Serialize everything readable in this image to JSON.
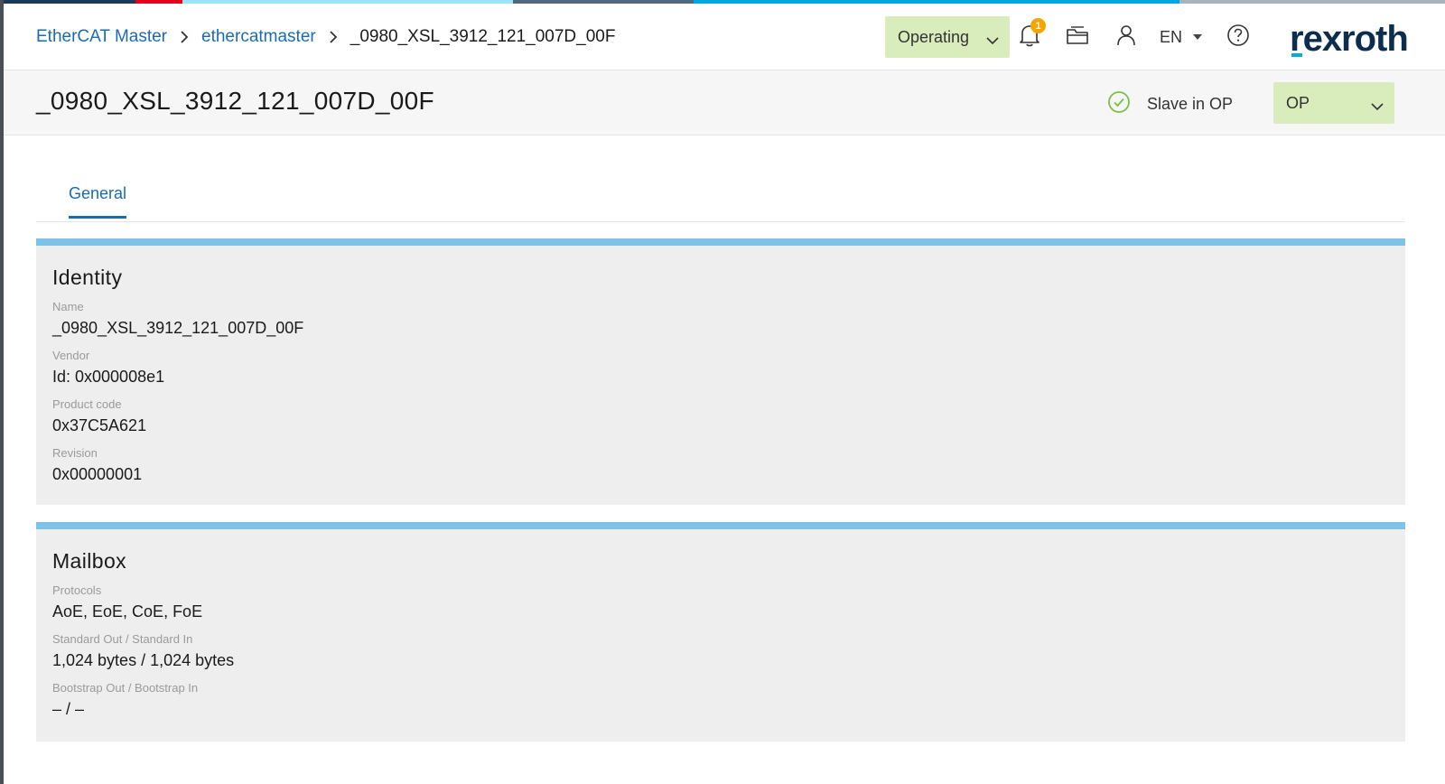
{
  "colors": {
    "accent": "#1a6bb0",
    "state_green": "#d8ecbc",
    "section_bar": "#7ec3e6",
    "badge": "#f5a400",
    "ok_green": "#7ac143"
  },
  "breadcrumb": {
    "items": [
      {
        "label": "EtherCAT Master"
      },
      {
        "label": "ethercatmaster"
      }
    ],
    "current": "_0980_XSL_3912_121_007D_00F"
  },
  "header": {
    "operating_state": "Operating",
    "notifications_count": "1",
    "language": "EN",
    "icons": [
      "bell-icon",
      "folder-icon",
      "user-icon",
      "help-icon"
    ],
    "logo": "rexroth"
  },
  "subheader": {
    "title": "_0980_XSL_3912_121_007D_00F",
    "status_text": "Slave in OP",
    "target_state": "OP"
  },
  "tabs": [
    {
      "label": "General"
    }
  ],
  "identity": {
    "title": "Identity",
    "fields": [
      {
        "label": "Name",
        "value": "_0980_XSL_3912_121_007D_00F"
      },
      {
        "label": "Vendor",
        "value": "Id: 0x000008e1"
      },
      {
        "label": "Product code",
        "value": "0x37C5A621"
      },
      {
        "label": "Revision",
        "value": "0x00000001"
      }
    ]
  },
  "mailbox": {
    "title": "Mailbox",
    "fields": [
      {
        "label": "Protocols",
        "value": "AoE, EoE, CoE, FoE"
      },
      {
        "label": "Standard Out / Standard In",
        "value": "1,024 bytes / 1,024 bytes"
      },
      {
        "label": "Bootstrap Out / Bootstrap In",
        "value": "– / –"
      }
    ]
  }
}
